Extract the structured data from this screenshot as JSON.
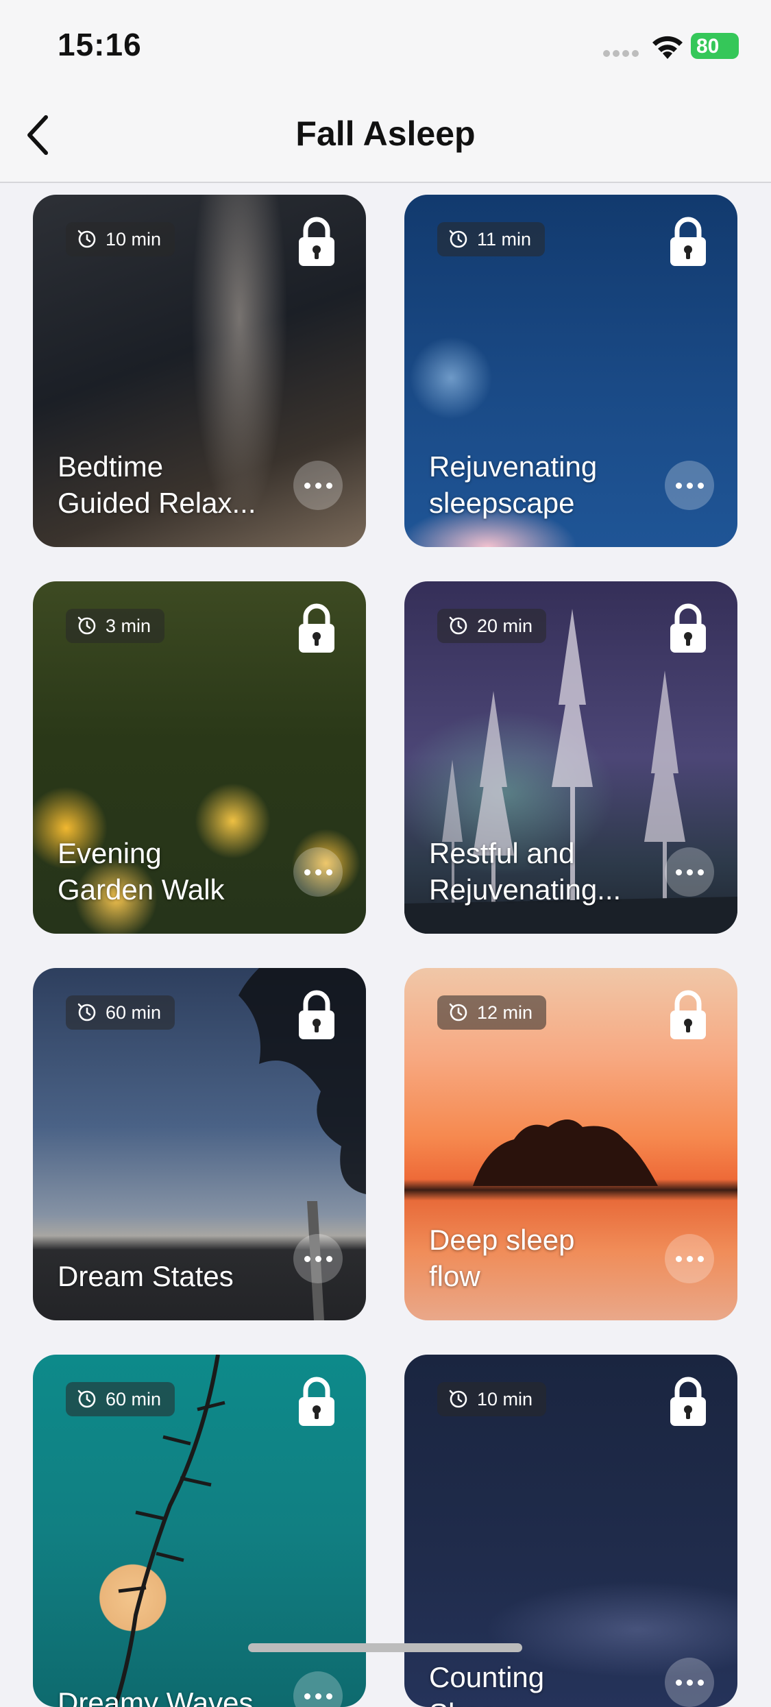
{
  "status_bar": {
    "time": "15:16",
    "battery": "80"
  },
  "nav": {
    "title": "Fall Asleep"
  },
  "cards": [
    {
      "duration": "10 min",
      "title": "Bedtime\nGuided Relax..."
    },
    {
      "duration": "11 min",
      "title": "Rejuvenating\nsleepscape"
    },
    {
      "duration": "3 min",
      "title": "Evening\nGarden Walk"
    },
    {
      "duration": "20 min",
      "title": "Restful and\nRejuvenating..."
    },
    {
      "duration": "60 min",
      "title": "Dream States"
    },
    {
      "duration": "12 min",
      "title": "Deep sleep\nflow"
    },
    {
      "duration": "60 min",
      "title": "Dreamy Waves"
    },
    {
      "duration": "10 min",
      "title": "Counting\nSheep"
    }
  ]
}
